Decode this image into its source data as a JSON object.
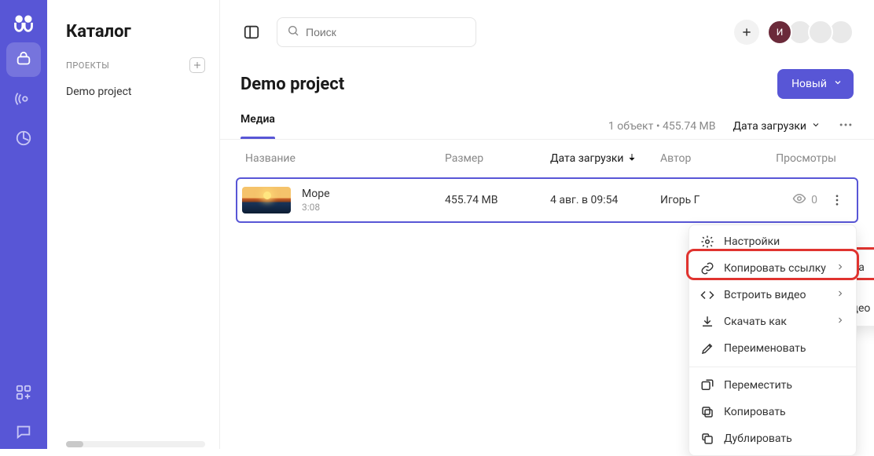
{
  "sidebar": {
    "title": "Каталог",
    "projects_header": "ПРОЕКТЫ",
    "item0": "Demo project"
  },
  "search": {
    "placeholder": "Поиск"
  },
  "avatar_initial": "И",
  "header": {
    "title": "Demo project",
    "new_btn": "Новый"
  },
  "tabs": {
    "media": "Медиа"
  },
  "meta": {
    "count": "1 объект • 455.74 MB",
    "sort": "Дата загрузки"
  },
  "cols": {
    "name": "Название",
    "size": "Размер",
    "date": "Дата загрузки",
    "author": "Автор",
    "views": "Просмотры"
  },
  "row": {
    "title": "Море",
    "dur": "3:08",
    "size": "455.74 MB",
    "date": "4 авг. в 09:54",
    "author": "Игорь Г",
    "views": "0"
  },
  "submenu": {
    "copy_video_link": "Скопировать ссылку на видео",
    "copy_uuid": "Скопировать UUID видео"
  },
  "ctx": {
    "settings": "Настройки",
    "copy_link": "Копировать ссылку",
    "embed": "Встроить видео",
    "download": "Скачать как",
    "rename": "Переименовать",
    "move": "Переместить",
    "copy": "Копировать",
    "dup": "Дублировать"
  }
}
